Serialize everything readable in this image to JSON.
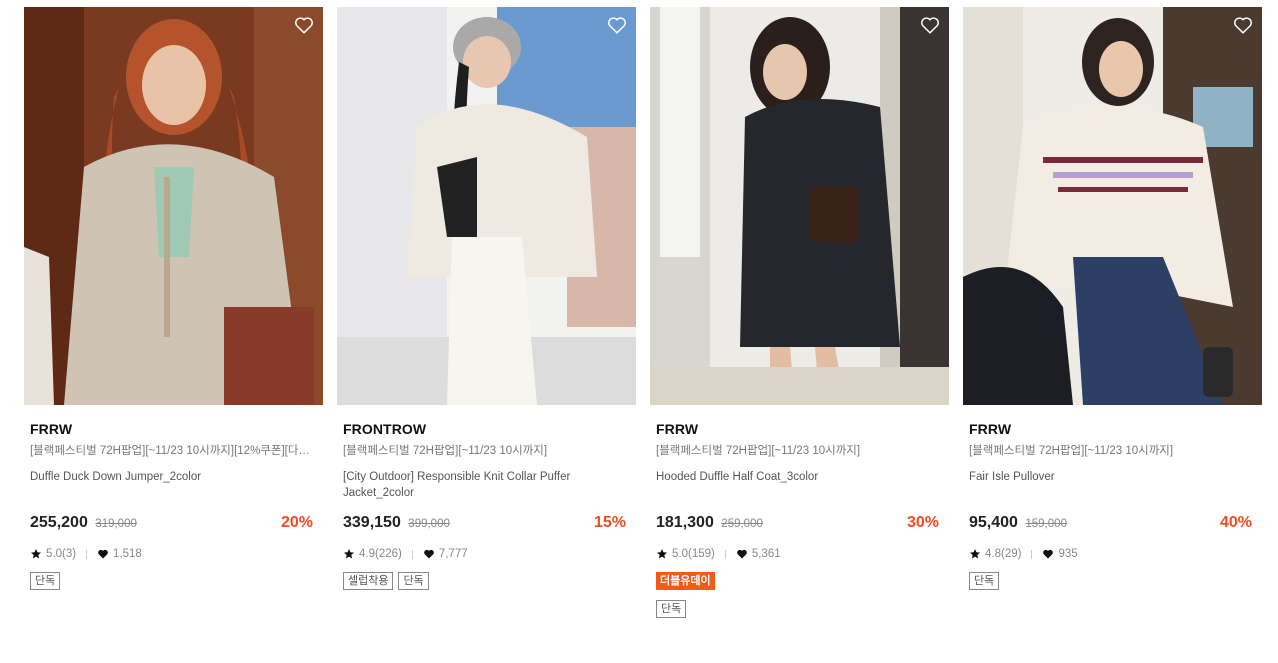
{
  "colors": {
    "discount": "#ef4c24",
    "event_badge": "#ef5a1d"
  },
  "icons": {
    "wishlist": "heart-outline-icon",
    "rating": "star-icon",
    "likes": "heart-icon"
  },
  "products": [
    {
      "brand": "FRRW",
      "promo": "[블랙페스티벌 72H팝업][~11/23 10시까지][12%쿠폰][다샤,...",
      "name": "Duffle Duck Down Jumper_2color",
      "price": "255,200",
      "original_price": "319,000",
      "discount": "20%",
      "rating": "5.0(3)",
      "likes": "1,518",
      "event_badge": "",
      "tags": [
        "단독"
      ]
    },
    {
      "brand": "FRONTROW",
      "promo": "[블랙페스티벌 72H팝업][~11/23 10시까지]",
      "name": "[City Outdoor] Responsible Knit Collar Puffer Jacket_2color",
      "price": "339,150",
      "original_price": "399,000",
      "discount": "15%",
      "rating": "4.9(226)",
      "likes": "7,777",
      "event_badge": "",
      "tags": [
        "셀럽착용",
        "단독"
      ]
    },
    {
      "brand": "FRRW",
      "promo": "[블랙페스티벌 72H팝업][~11/23 10시까지]",
      "name": "Hooded Duffle Half Coat_3color",
      "price": "181,300",
      "original_price": "259,000",
      "discount": "30%",
      "rating": "5.0(159)",
      "likes": "5,361",
      "event_badge": "더블유데이",
      "tags": [
        "단독"
      ]
    },
    {
      "brand": "FRRW",
      "promo": "[블랙페스티벌 72H팝업][~11/23 10시까지]",
      "name": "Fair Isle Pullover",
      "price": "95,400",
      "original_price": "159,000",
      "discount": "40%",
      "rating": "4.8(29)",
      "likes": "935",
      "event_badge": "",
      "tags": [
        "단독"
      ]
    }
  ]
}
